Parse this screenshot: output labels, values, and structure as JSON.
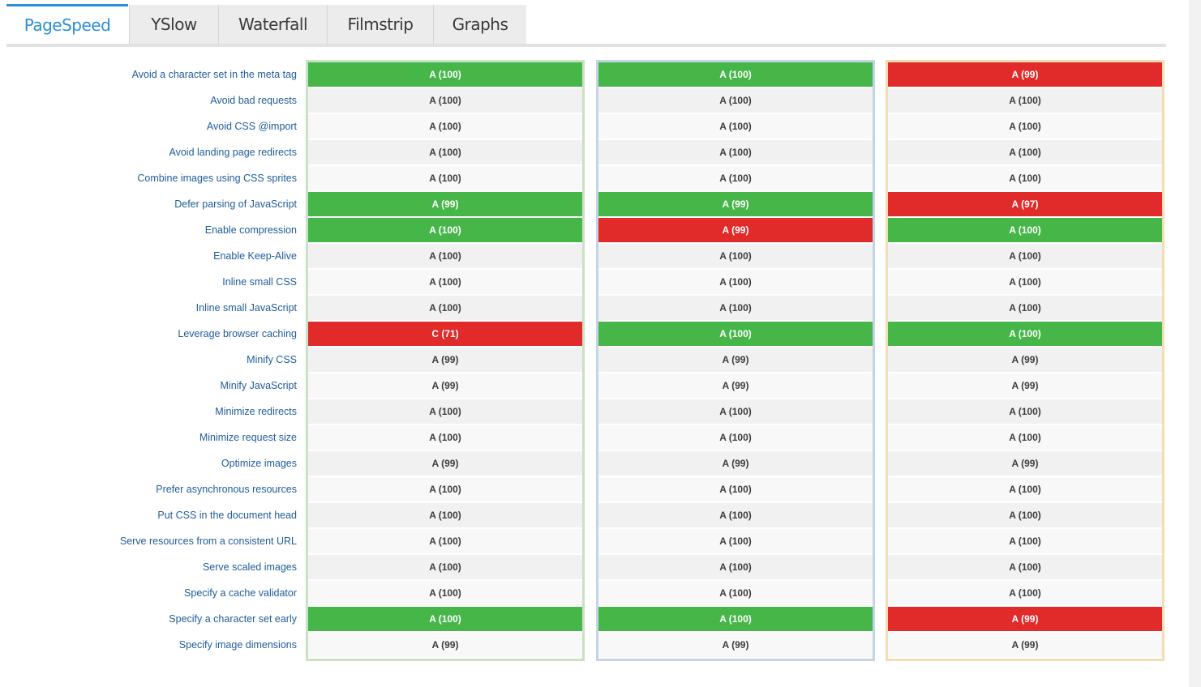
{
  "tabs": [
    {
      "label": "PageSpeed",
      "active": true
    },
    {
      "label": "YSlow",
      "active": false
    },
    {
      "label": "Waterfall",
      "active": false
    },
    {
      "label": "Filmstrip",
      "active": false
    },
    {
      "label": "Graphs",
      "active": false
    }
  ],
  "rules": [
    "Avoid a character set in the meta tag",
    "Avoid bad requests",
    "Avoid CSS @import",
    "Avoid landing page redirects",
    "Combine images using CSS sprites",
    "Defer parsing of JavaScript",
    "Enable compression",
    "Enable Keep-Alive",
    "Inline small CSS",
    "Inline small JavaScript",
    "Leverage browser caching",
    "Minify CSS",
    "Minify JavaScript",
    "Minimize redirects",
    "Minimize request size",
    "Optimize images",
    "Prefer asynchronous resources",
    "Put CSS in the document head",
    "Serve resources from a consistent URL",
    "Serve scaled images",
    "Specify a cache validator",
    "Specify a character set early",
    "Specify image dimensions"
  ],
  "columns": [
    {
      "border_color": "#c9e2c3",
      "scores": [
        {
          "text": "A (100)",
          "status": "green"
        },
        {
          "text": "A (100)",
          "status": "none"
        },
        {
          "text": "A (100)",
          "status": "none"
        },
        {
          "text": "A (100)",
          "status": "none"
        },
        {
          "text": "A (100)",
          "status": "none"
        },
        {
          "text": "A (99)",
          "status": "green"
        },
        {
          "text": "A (100)",
          "status": "green"
        },
        {
          "text": "A (100)",
          "status": "none"
        },
        {
          "text": "A (100)",
          "status": "none"
        },
        {
          "text": "A (100)",
          "status": "none"
        },
        {
          "text": "C (71)",
          "status": "red"
        },
        {
          "text": "A (99)",
          "status": "none"
        },
        {
          "text": "A (99)",
          "status": "none"
        },
        {
          "text": "A (100)",
          "status": "none"
        },
        {
          "text": "A (100)",
          "status": "none"
        },
        {
          "text": "A (99)",
          "status": "none"
        },
        {
          "text": "A (100)",
          "status": "none"
        },
        {
          "text": "A (100)",
          "status": "none"
        },
        {
          "text": "A (100)",
          "status": "none"
        },
        {
          "text": "A (100)",
          "status": "none"
        },
        {
          "text": "A (100)",
          "status": "none"
        },
        {
          "text": "A (100)",
          "status": "green"
        },
        {
          "text": "A (99)",
          "status": "none"
        }
      ]
    },
    {
      "border_color": "#c3d4e6",
      "scores": [
        {
          "text": "A (100)",
          "status": "green"
        },
        {
          "text": "A (100)",
          "status": "none"
        },
        {
          "text": "A (100)",
          "status": "none"
        },
        {
          "text": "A (100)",
          "status": "none"
        },
        {
          "text": "A (100)",
          "status": "none"
        },
        {
          "text": "A (99)",
          "status": "green"
        },
        {
          "text": "A (99)",
          "status": "red"
        },
        {
          "text": "A (100)",
          "status": "none"
        },
        {
          "text": "A (100)",
          "status": "none"
        },
        {
          "text": "A (100)",
          "status": "none"
        },
        {
          "text": "A (100)",
          "status": "green"
        },
        {
          "text": "A (99)",
          "status": "none"
        },
        {
          "text": "A (99)",
          "status": "none"
        },
        {
          "text": "A (100)",
          "status": "none"
        },
        {
          "text": "A (100)",
          "status": "none"
        },
        {
          "text": "A (99)",
          "status": "none"
        },
        {
          "text": "A (100)",
          "status": "none"
        },
        {
          "text": "A (100)",
          "status": "none"
        },
        {
          "text": "A (100)",
          "status": "none"
        },
        {
          "text": "A (100)",
          "status": "none"
        },
        {
          "text": "A (100)",
          "status": "none"
        },
        {
          "text": "A (100)",
          "status": "green"
        },
        {
          "text": "A (99)",
          "status": "none"
        }
      ]
    },
    {
      "border_color": "#f4ddb3",
      "scores": [
        {
          "text": "A (99)",
          "status": "red"
        },
        {
          "text": "A (100)",
          "status": "none"
        },
        {
          "text": "A (100)",
          "status": "none"
        },
        {
          "text": "A (100)",
          "status": "none"
        },
        {
          "text": "A (100)",
          "status": "none"
        },
        {
          "text": "A (97)",
          "status": "red"
        },
        {
          "text": "A (100)",
          "status": "green"
        },
        {
          "text": "A (100)",
          "status": "none"
        },
        {
          "text": "A (100)",
          "status": "none"
        },
        {
          "text": "A (100)",
          "status": "none"
        },
        {
          "text": "A (100)",
          "status": "green"
        },
        {
          "text": "A (99)",
          "status": "none"
        },
        {
          "text": "A (99)",
          "status": "none"
        },
        {
          "text": "A (100)",
          "status": "none"
        },
        {
          "text": "A (100)",
          "status": "none"
        },
        {
          "text": "A (99)",
          "status": "none"
        },
        {
          "text": "A (100)",
          "status": "none"
        },
        {
          "text": "A (100)",
          "status": "none"
        },
        {
          "text": "A (100)",
          "status": "none"
        },
        {
          "text": "A (100)",
          "status": "none"
        },
        {
          "text": "A (100)",
          "status": "none"
        },
        {
          "text": "A (99)",
          "status": "red"
        },
        {
          "text": "A (99)",
          "status": "none"
        }
      ]
    }
  ],
  "colors": {
    "accent": "#2b8fd6",
    "good": "#46b649",
    "bad": "#e12a2a",
    "label_text": "#1f5c99"
  }
}
